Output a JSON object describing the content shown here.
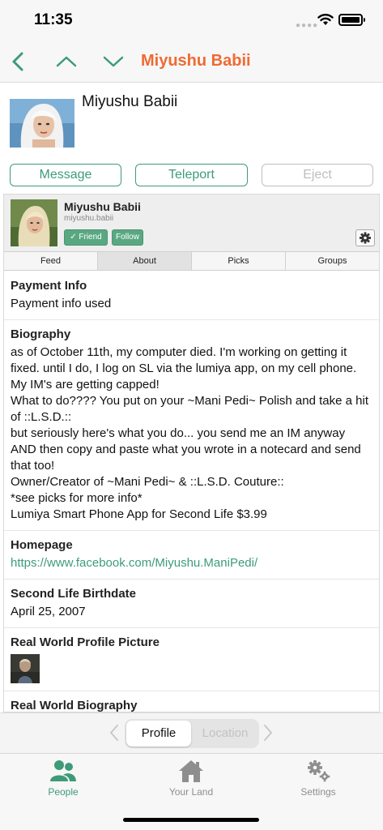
{
  "status_bar": {
    "time": "11:35"
  },
  "nav": {
    "title": "Miyushu Babii"
  },
  "header": {
    "name": "Miyushu Babii"
  },
  "actions": {
    "message": "Message",
    "teleport": "Teleport",
    "eject": "Eject"
  },
  "card": {
    "name": "Miyushu Babii",
    "username": "miyushu.babii",
    "friend_label": "✓ Friend",
    "follow_label": "Follow"
  },
  "tabs": [
    {
      "label": "Feed"
    },
    {
      "label": "About"
    },
    {
      "label": "Picks"
    },
    {
      "label": "Groups"
    }
  ],
  "sections": {
    "payment": {
      "title": "Payment Info",
      "value": "Payment info used"
    },
    "biography": {
      "title": "Biography",
      "lines": [
        "as of October 11th, my computer died. I'm working on getting it fixed. until I do, I log on SL via the lumiya app, on my cell phone. My IM's are getting capped!",
        "What to do???? You put on your ~Mani Pedi~ Polish and take a hit of ::L.S.D.::",
        "but seriously here's what you do... you send me an IM anyway AND then copy and paste what you wrote in a notecard and send that too!",
        "Owner/Creator of ~Mani Pedi~ & ::L.S.D. Couture::",
        "*see picks for more info*",
        "Lumiya Smart Phone App for Second Life $3.99"
      ]
    },
    "homepage": {
      "title": "Homepage",
      "url": "https://www.facebook.com/Miyushu.ManiPedi/"
    },
    "birthdate": {
      "title": "Second Life Birthdate",
      "value": "April 25, 2007"
    },
    "rw_picture": {
      "title": "Real World Profile Picture"
    },
    "rw_biography": {
      "title": "Real World Biography"
    }
  },
  "segment": {
    "profile": "Profile",
    "location": "Location"
  },
  "tab_bar": {
    "people": "People",
    "your_land": "Your Land",
    "settings": "Settings"
  },
  "colors": {
    "accent": "#3e9b78",
    "title": "#f06a32",
    "disabled": "#bdbdbd"
  }
}
